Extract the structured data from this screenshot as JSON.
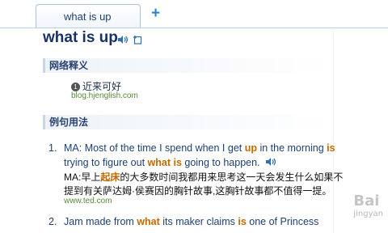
{
  "tab": {
    "label": "what is up",
    "add_icon": "plus-icon"
  },
  "entry": {
    "headword": "what is up",
    "icons": [
      "speaker-icon",
      "add-to-wordbook-icon"
    ]
  },
  "sections": {
    "web_definition": {
      "title": "网络释义",
      "items": [
        {
          "num": "1",
          "text": "近来可好",
          "source": "blog.hjenglish.com"
        }
      ]
    },
    "examples": {
      "title": "例句用法",
      "items": [
        {
          "num": "1.",
          "en_line1": {
            "p1": "MA: Most of the time I spend when I get ",
            "h1": "up",
            "p2": " in the morning ",
            "h2": "is"
          },
          "en_line2": {
            "p1": "trying to figure out ",
            "h1": "what is",
            "p2": " going to happen."
          },
          "cn_line1": {
            "p1": "MA:早上",
            "h1": "起床",
            "p2": "的大多数时间我都用来思考这一天会发生什么如果不"
          },
          "cn_line2": "提到有关萨达姆·侯赛因的胸针故事,这胸针故事都不值得一提。",
          "source": "www.ted.com"
        },
        {
          "num": "2.",
          "en_line1": {
            "p1": "Jam made from ",
            "h1": "what",
            "p2": " its maker claims ",
            "h2": "is",
            "p3": " one of Princess"
          }
        }
      ]
    }
  },
  "watermark": {
    "text": "Bai",
    "sub": "jingyan"
  },
  "colors": {
    "highlight": "#c26a00",
    "link_green": "#5a8a3a",
    "tab_border": "#a9c2dc",
    "add_blue": "#2f7fd0"
  }
}
